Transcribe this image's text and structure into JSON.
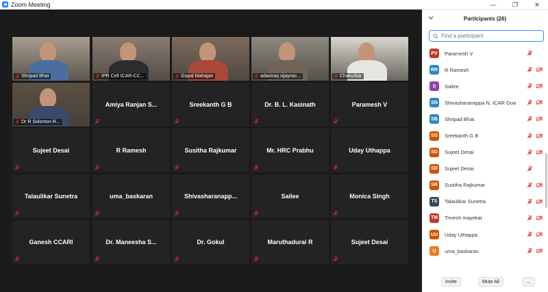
{
  "window": {
    "title": "Zoom Meeting",
    "controls": [
      "—",
      "❐",
      "✕"
    ]
  },
  "colors": {
    "accent": "#2d8cff",
    "active_speaker": "#a7e43b",
    "muted": "#e02828",
    "tile_bg": "#232323"
  },
  "video_tiles": [
    {
      "label": "Shripad Bhat"
    },
    {
      "label": "IPR Cell ICAR-CC..."
    },
    {
      "label": "Gopal Mahajan"
    },
    {
      "label": "adaviraq vijayrao..."
    },
    {
      "label": "Chakurkar"
    },
    {
      "label": "Dr R Solomon R..."
    }
  ],
  "name_tiles": [
    "Amiya Ranjan S...",
    "Sreekanth G B",
    "Dr. B. L. Kasinath",
    "Paramesh V",
    "Sujeet Desai",
    "R Ramesh",
    "Susitha Rajkumar",
    "Mr. HRC Prabhu",
    "Uday Uthappa",
    "Talaulikar Sunetra",
    "uma_baskaran",
    "Shivasharanapp...",
    "Sailee",
    "Monica Singh",
    "Ganesh CCARI",
    "Dr. Maneesha S...",
    "Dr. Gokul",
    "Maruthadurai R",
    "Sujeet Desai"
  ],
  "panel": {
    "title": "Participants (26)",
    "search_placeholder": "Find a participant",
    "participants": [
      {
        "initials": "PV",
        "name": "Paramesh V",
        "color": "#c0392b",
        "video": false
      },
      {
        "initials": "RR",
        "name": "R Ramesh",
        "color": "#2e86c1",
        "video": true
      },
      {
        "initials": "S",
        "name": "Sailee",
        "color": "#8e44ad",
        "video": true
      },
      {
        "initials": "SN",
        "name": "Shivasharanappa N, ICAR Goa",
        "color": "#2e86c1",
        "video": true
      },
      {
        "initials": "SB",
        "name": "Shripad Bhat",
        "color": "#2e86c1",
        "video": true
      },
      {
        "initials": "SG",
        "name": "Sreekanth G B",
        "color": "#d35400",
        "video": true
      },
      {
        "initials": "SD",
        "name": "Sujeet Desai",
        "color": "#d35400",
        "video": true
      },
      {
        "initials": "SD",
        "name": "Sujeet Desai",
        "color": "#d35400",
        "video": false
      },
      {
        "initials": "SR",
        "name": "Susitha Rajkumar",
        "color": "#d35400",
        "video": true
      },
      {
        "initials": "TS",
        "name": "Talaulikar Sunetra",
        "color": "#34495e",
        "video": true
      },
      {
        "initials": "TM",
        "name": "Trivesh mayekar",
        "color": "#c0392b",
        "video": true
      },
      {
        "initials": "UU",
        "name": "Uday Uthappa",
        "color": "#d35400",
        "video": true
      },
      {
        "initials": "U",
        "name": "uma_baskaran",
        "color": "#e67e22",
        "video": true
      }
    ],
    "footer": {
      "invite": "Invite",
      "mute_all": "Mute All",
      "more": "..."
    }
  }
}
